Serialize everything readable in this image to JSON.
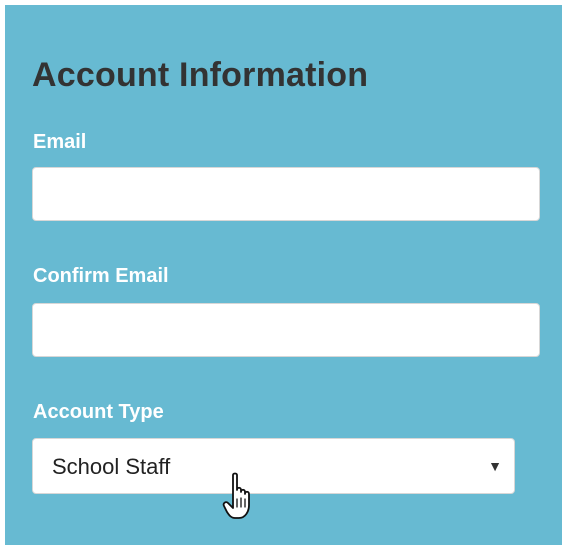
{
  "form": {
    "title": "Account Information",
    "email_label": "Email",
    "email_value": "",
    "confirm_email_label": "Confirm Email",
    "confirm_email_value": "",
    "account_type_label": "Account Type",
    "account_type_selected": "School Staff",
    "dropdown_caret": "▼"
  },
  "colors": {
    "panel_background": "#67bad2",
    "title_text": "#333333",
    "label_text": "#ffffff"
  },
  "icons": {
    "cursor": "hand-pointer-icon"
  }
}
